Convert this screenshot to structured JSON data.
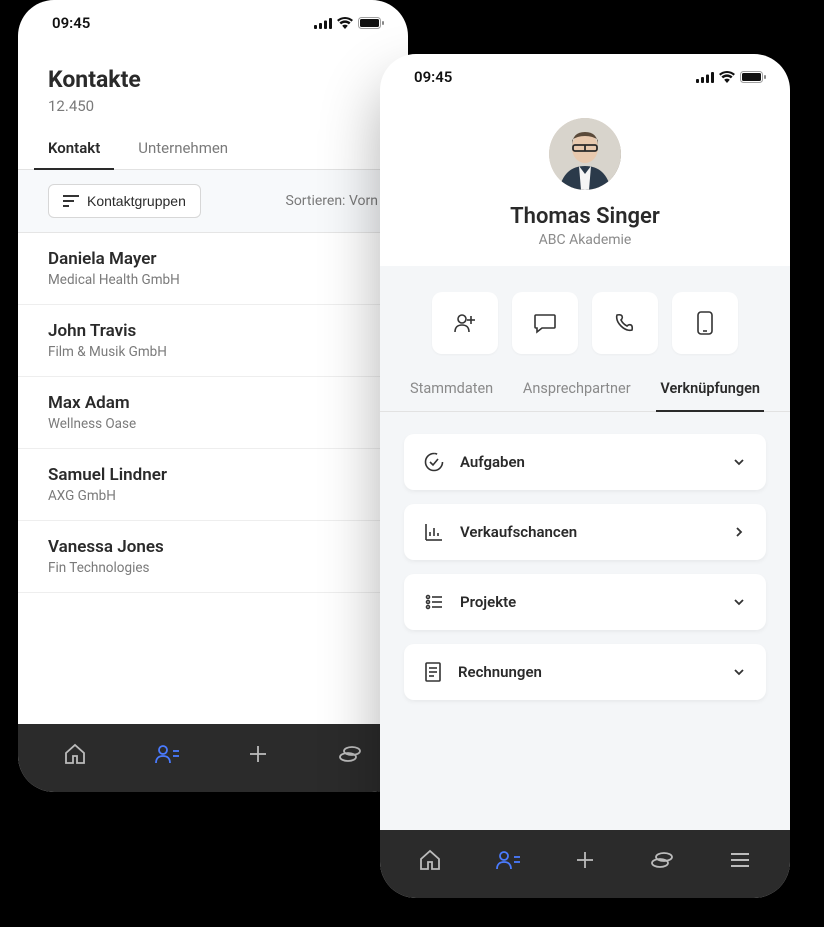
{
  "statusTime": "09:45",
  "left": {
    "title": "Kontakte",
    "count": "12.450",
    "tabs": {
      "contact": "Kontakt",
      "company": "Unternehmen"
    },
    "filterBtn": "Kontaktgruppen",
    "sortLabel": "Sortieren:",
    "sortValue": "Vorn",
    "contacts": [
      {
        "name": "Daniela Mayer",
        "company": "Medical Health GmbH"
      },
      {
        "name": "John Travis",
        "company": "Film & Musik GmbH"
      },
      {
        "name": "Max Adam",
        "company": "Wellness Oase"
      },
      {
        "name": "Samuel Lindner",
        "company": "AXG GmbH"
      },
      {
        "name": "Vanessa Jones",
        "company": "Fin Technologies"
      }
    ]
  },
  "right": {
    "profile": {
      "name": "Thomas Singer",
      "company": "ABC Akademie"
    },
    "detailTabs": {
      "main": "Stammdaten",
      "contactPersons": "Ansprechpartner",
      "links": "Verknüpfungen"
    },
    "cards": {
      "tasks": "Aufgaben",
      "opportunities": "Verkaufschancen",
      "projects": "Projekte",
      "invoices": "Rechnungen"
    }
  }
}
